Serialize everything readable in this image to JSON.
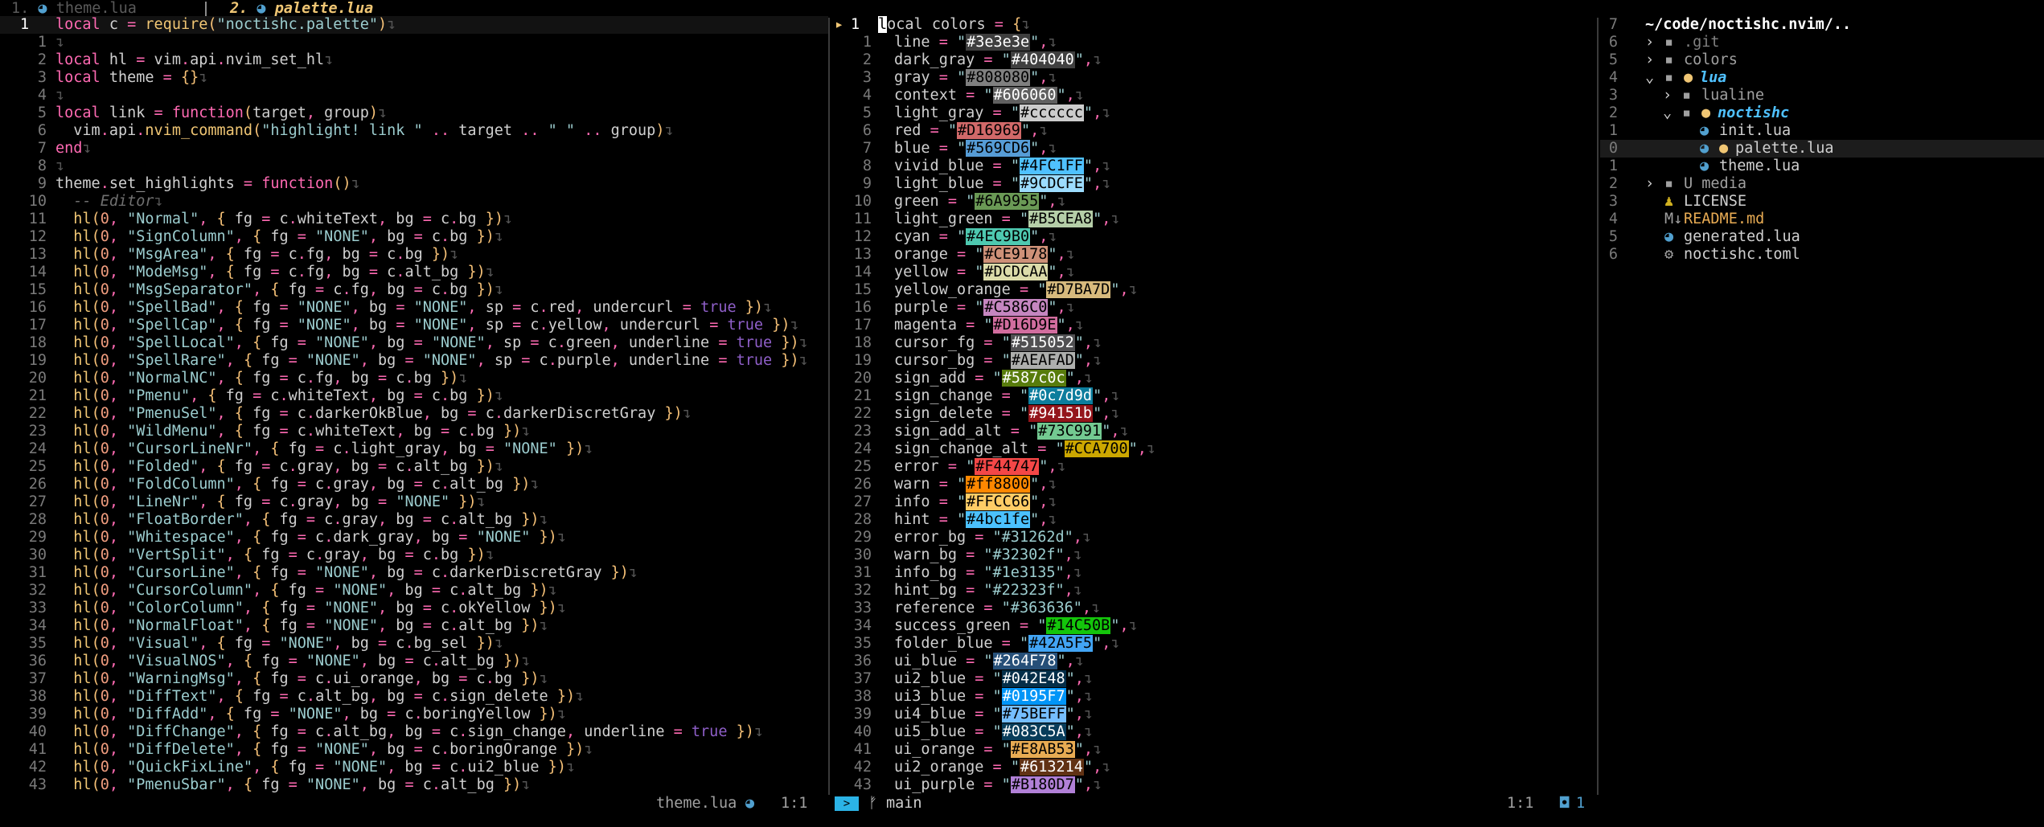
{
  "tabs": [
    {
      "num": "1.",
      "name": "theme.lua",
      "active": false
    },
    {
      "num": "2.",
      "name": "palette.lua",
      "active": true
    }
  ],
  "left": {
    "lines": [
      {
        "n": "1",
        "cur": true,
        "t": "local c = require(\"noctishc.palette\")"
      },
      {
        "n": "1",
        "t": ""
      },
      {
        "n": "2",
        "t": "local hl = vim.api.nvim_set_hl"
      },
      {
        "n": "3",
        "t": "local theme = {}"
      },
      {
        "n": "4",
        "t": ""
      },
      {
        "n": "5",
        "t": "local link = function(target, group)"
      },
      {
        "n": "6",
        "t": "  vim.api.nvim_command(\"highlight! link \" .. target .. \" \" .. group)"
      },
      {
        "n": "7",
        "t": "end"
      },
      {
        "n": "8",
        "t": ""
      },
      {
        "n": "9",
        "t": "theme.set_highlights = function()"
      },
      {
        "n": "10",
        "t": "  -- Editor"
      },
      {
        "n": "11",
        "t": "  hl(0, \"Normal\", { fg = c.whiteText, bg = c.bg })"
      },
      {
        "n": "12",
        "t": "  hl(0, \"SignColumn\", { fg = \"NONE\", bg = c.bg })"
      },
      {
        "n": "13",
        "t": "  hl(0, \"MsgArea\", { fg = c.fg, bg = c.bg })"
      },
      {
        "n": "14",
        "t": "  hl(0, \"ModeMsg\", { fg = c.fg, bg = c.alt_bg })"
      },
      {
        "n": "15",
        "t": "  hl(0, \"MsgSeparator\", { fg = c.fg, bg = c.bg })"
      },
      {
        "n": "16",
        "t": "  hl(0, \"SpellBad\", { fg = \"NONE\", bg = \"NONE\", sp = c.red, undercurl = true })"
      },
      {
        "n": "17",
        "t": "  hl(0, \"SpellCap\", { fg = \"NONE\", bg = \"NONE\", sp = c.yellow, undercurl = true })"
      },
      {
        "n": "18",
        "t": "  hl(0, \"SpellLocal\", { fg = \"NONE\", bg = \"NONE\", sp = c.green, underline = true })"
      },
      {
        "n": "19",
        "t": "  hl(0, \"SpellRare\", { fg = \"NONE\", bg = \"NONE\", sp = c.purple, underline = true })"
      },
      {
        "n": "20",
        "t": "  hl(0, \"NormalNC\", { fg = c.fg, bg = c.bg })"
      },
      {
        "n": "21",
        "t": "  hl(0, \"Pmenu\", { fg = c.whiteText, bg = c.bg })"
      },
      {
        "n": "22",
        "t": "  hl(0, \"PmenuSel\", { fg = c.darkerOkBlue, bg = c.darkerDiscretGray })"
      },
      {
        "n": "23",
        "t": "  hl(0, \"WildMenu\", { fg = c.whiteText, bg = c.bg })"
      },
      {
        "n": "24",
        "t": "  hl(0, \"CursorLineNr\", { fg = c.light_gray, bg = \"NONE\" })"
      },
      {
        "n": "25",
        "t": "  hl(0, \"Folded\", { fg = c.gray, bg = c.alt_bg })"
      },
      {
        "n": "26",
        "t": "  hl(0, \"FoldColumn\", { fg = c.gray, bg = c.alt_bg })"
      },
      {
        "n": "27",
        "t": "  hl(0, \"LineNr\", { fg = c.gray, bg = \"NONE\" })"
      },
      {
        "n": "28",
        "t": "  hl(0, \"FloatBorder\", { fg = c.gray, bg = c.alt_bg })"
      },
      {
        "n": "29",
        "t": "  hl(0, \"Whitespace\", { fg = c.dark_gray, bg = \"NONE\" })"
      },
      {
        "n": "30",
        "t": "  hl(0, \"VertSplit\", { fg = c.gray, bg = c.bg })"
      },
      {
        "n": "31",
        "t": "  hl(0, \"CursorLine\", { fg = \"NONE\", bg = c.darkerDiscretGray })"
      },
      {
        "n": "32",
        "t": "  hl(0, \"CursorColumn\", { fg = \"NONE\", bg = c.alt_bg })"
      },
      {
        "n": "33",
        "t": "  hl(0, \"ColorColumn\", { fg = \"NONE\", bg = c.okYellow })"
      },
      {
        "n": "34",
        "t": "  hl(0, \"NormalFloat\", { fg = \"NONE\", bg = c.alt_bg })"
      },
      {
        "n": "35",
        "t": "  hl(0, \"Visual\", { fg = \"NONE\", bg = c.bg_sel })"
      },
      {
        "n": "36",
        "t": "  hl(0, \"VisualNOS\", { fg = \"NONE\", bg = c.alt_bg })"
      },
      {
        "n": "37",
        "t": "  hl(0, \"WarningMsg\", { fg = c.ui_orange, bg = c.bg })"
      },
      {
        "n": "38",
        "t": "  hl(0, \"DiffText\", { fg = c.alt_bg, bg = c.sign_delete })"
      },
      {
        "n": "39",
        "t": "  hl(0, \"DiffAdd\", { fg = \"NONE\", bg = c.boringYellow })"
      },
      {
        "n": "40",
        "t": "  hl(0, \"DiffChange\", { fg = c.alt_bg, bg = c.sign_change, underline = true })"
      },
      {
        "n": "41",
        "t": "  hl(0, \"DiffDelete\", { fg = \"NONE\", bg = c.boringOrange })"
      },
      {
        "n": "42",
        "t": "  hl(0, \"QuickFixLine\", { fg = \"NONE\", bg = c.ui2_blue })"
      },
      {
        "n": "43",
        "t": "  hl(0, \"PmenuSbar\", { fg = \"NONE\", bg = c.alt_bg })"
      }
    ]
  },
  "right": {
    "first_line": {
      "n": "1",
      "t": "local colors = {"
    },
    "entries": [
      {
        "n": "1",
        "k": "line",
        "v": "#3e3e3e"
      },
      {
        "n": "2",
        "k": "dark_gray",
        "v": "#404040"
      },
      {
        "n": "3",
        "k": "gray",
        "v": "#808080"
      },
      {
        "n": "4",
        "k": "context",
        "v": "#606060"
      },
      {
        "n": "5",
        "k": "light_gray",
        "v": "#cccccc"
      },
      {
        "n": "6",
        "k": "red",
        "v": "#D16969"
      },
      {
        "n": "7",
        "k": "blue",
        "v": "#569CD6"
      },
      {
        "n": "8",
        "k": "vivid_blue",
        "v": "#4FC1FF"
      },
      {
        "n": "9",
        "k": "light_blue",
        "v": "#9CDCFE"
      },
      {
        "n": "10",
        "k": "green",
        "v": "#6A9955"
      },
      {
        "n": "11",
        "k": "light_green",
        "v": "#B5CEA8"
      },
      {
        "n": "12",
        "k": "cyan",
        "v": "#4EC9B0"
      },
      {
        "n": "13",
        "k": "orange",
        "v": "#CE9178"
      },
      {
        "n": "14",
        "k": "yellow",
        "v": "#DCDCAA"
      },
      {
        "n": "15",
        "k": "yellow_orange",
        "v": "#D7BA7D"
      },
      {
        "n": "16",
        "k": "purple",
        "v": "#C586C0"
      },
      {
        "n": "17",
        "k": "magenta",
        "v": "#D16D9E"
      },
      {
        "n": "18",
        "k": "cursor_fg",
        "v": "#515052"
      },
      {
        "n": "19",
        "k": "cursor_bg",
        "v": "#AEAFAD"
      },
      {
        "n": "20",
        "k": "sign_add",
        "v": "#587c0c"
      },
      {
        "n": "21",
        "k": "sign_change",
        "v": "#0c7d9d"
      },
      {
        "n": "22",
        "k": "sign_delete",
        "v": "#94151b"
      },
      {
        "n": "23",
        "k": "sign_add_alt",
        "v": "#73C991"
      },
      {
        "n": "24",
        "k": "sign_change_alt",
        "v": "#CCA700"
      },
      {
        "n": "25",
        "k": "error",
        "v": "#F44747"
      },
      {
        "n": "26",
        "k": "warn",
        "v": "#ff8800"
      },
      {
        "n": "27",
        "k": "info",
        "v": "#FFCC66"
      },
      {
        "n": "28",
        "k": "hint",
        "v": "#4bc1fe"
      },
      {
        "n": "29",
        "k": "error_bg",
        "v": "#31262d",
        "plain": true
      },
      {
        "n": "30",
        "k": "warn_bg",
        "v": "#32302f",
        "plain": true
      },
      {
        "n": "31",
        "k": "info_bg",
        "v": "#1e3135",
        "plain": true
      },
      {
        "n": "32",
        "k": "hint_bg",
        "v": "#22323f",
        "plain": true
      },
      {
        "n": "33",
        "k": "reference",
        "v": "#363636",
        "plain": true
      },
      {
        "n": "34",
        "k": "success_green",
        "v": "#14C50B"
      },
      {
        "n": "35",
        "k": "folder_blue",
        "v": "#42A5F5"
      },
      {
        "n": "36",
        "k": "ui_blue",
        "v": "#264F78"
      },
      {
        "n": "37",
        "k": "ui2_blue",
        "v": "#042E48"
      },
      {
        "n": "38",
        "k": "ui3_blue",
        "v": "#0195F7"
      },
      {
        "n": "39",
        "k": "ui4_blue",
        "v": "#75BEFF"
      },
      {
        "n": "40",
        "k": "ui5_blue",
        "v": "#083C5A"
      },
      {
        "n": "41",
        "k": "ui_orange",
        "v": "#E8AB53"
      },
      {
        "n": "42",
        "k": "ui2_orange",
        "v": "#613214"
      },
      {
        "n": "43",
        "k": "ui_purple",
        "v": "#B180D7"
      }
    ]
  },
  "tree": {
    "root": "~/code/noctishc.nvim/..",
    "root_nr": "7",
    "items": [
      {
        "n": "6",
        "indent": 0,
        "arrow": "›",
        "icon": "▪",
        "label": ".git",
        "color": "#808080",
        "dot": false
      },
      {
        "n": "5",
        "indent": 0,
        "arrow": "›",
        "icon": "▪",
        "label": "colors",
        "color": "#a0a0a0",
        "dot": false
      },
      {
        "n": "4",
        "indent": 0,
        "arrow": "⌄",
        "icon": "▪",
        "label": "lua",
        "color": "#4FC1FF",
        "dot": true,
        "bold": true
      },
      {
        "n": "3",
        "indent": 1,
        "arrow": "›",
        "icon": "▪",
        "label": "lualine",
        "color": "#a0a0a0",
        "dot": false
      },
      {
        "n": "2",
        "indent": 1,
        "arrow": "⌄",
        "icon": "▪",
        "label": "noctishc",
        "color": "#4FC1FF",
        "dot": true,
        "bold": true
      },
      {
        "n": "1",
        "indent": 2,
        "arrow": "",
        "icon": "◕",
        "label": "init.lua",
        "color": "#d0d0d0",
        "dot": false
      },
      {
        "n": "0",
        "indent": 2,
        "arrow": "",
        "icon": "◕",
        "label": "palette.lua",
        "color": "#d0d0d0",
        "dot": true,
        "sel": true
      },
      {
        "n": "1",
        "indent": 2,
        "arrow": "",
        "icon": "◕",
        "label": "theme.lua",
        "color": "#d0d0d0",
        "dot": false
      },
      {
        "n": "2",
        "indent": 0,
        "arrow": "›",
        "icon": "▪",
        "label": "U media",
        "color": "#a0a0a0",
        "dot": false
      },
      {
        "n": "3",
        "indent": 0,
        "arrow": "",
        "icon": "♟",
        "label": "LICENSE",
        "color": "#d0d0d0",
        "dot": false
      },
      {
        "n": "4",
        "indent": 0,
        "arrow": "",
        "icon": "M↓",
        "label": "README.md",
        "color": "#E8AB53",
        "dot": false
      },
      {
        "n": "5",
        "indent": 0,
        "arrow": "",
        "icon": "◕",
        "label": "generated.lua",
        "color": "#d0d0d0",
        "dot": false
      },
      {
        "n": "6",
        "indent": 0,
        "arrow": "",
        "icon": "⚙",
        "label": "noctishc.toml",
        "color": "#d0d0d0",
        "dot": false
      }
    ]
  },
  "status": {
    "left_file": "theme.lua",
    "left_pos": "1:1",
    "branch": "main",
    "right_pos": "1:1",
    "buf_count": "1"
  }
}
